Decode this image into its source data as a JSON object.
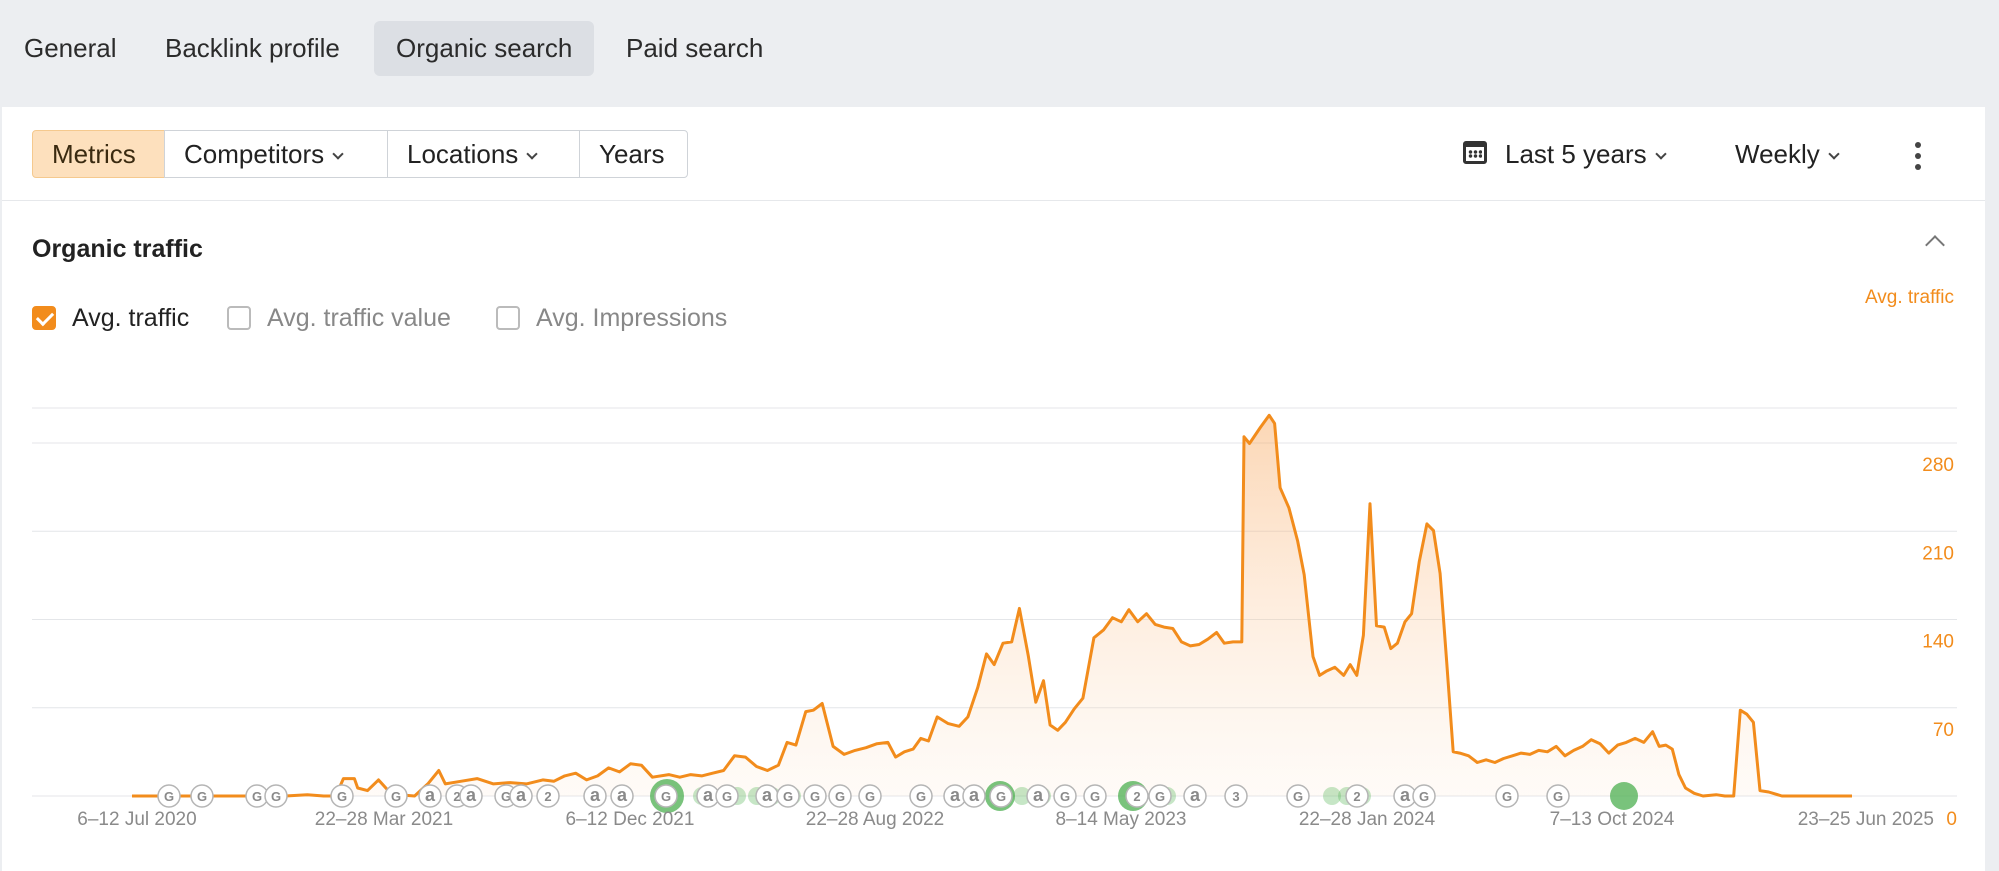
{
  "tabs": [
    {
      "label": "General",
      "active": false
    },
    {
      "label": "Backlink profile",
      "active": false
    },
    {
      "label": "Organic search",
      "active": true
    },
    {
      "label": "Paid search",
      "active": false
    }
  ],
  "toolbar": {
    "segments": [
      {
        "label": "Metrics",
        "active": true
      },
      {
        "label": "Competitors",
        "dropdown": true
      },
      {
        "label": "Locations",
        "dropdown": true
      },
      {
        "label": "Years",
        "dropdown": false
      }
    ],
    "date_range": "Last 5 years",
    "interval": "Weekly",
    "icons": {
      "calendar": "calendar-icon",
      "more": "more-vertical-icon"
    }
  },
  "section": {
    "title": "Organic traffic",
    "checkboxes": [
      {
        "label": "Avg. traffic",
        "checked": true
      },
      {
        "label": "Avg. traffic value",
        "checked": false
      },
      {
        "label": "Avg. Impressions",
        "checked": false
      }
    ]
  },
  "colors": {
    "accent": "#f28c1c",
    "marker_green": "#5cb85c",
    "marker_outline": "#b5b5b5"
  },
  "chart_data": {
    "type": "area",
    "series_label": "Avg. traffic",
    "y_ticks": [
      0,
      70,
      140,
      210,
      280
    ],
    "ylim": [
      0,
      285
    ],
    "x_tick_labels": [
      "6–12 Jul 2020",
      "22–28 Mar 2021",
      "6–12 Dec 2021",
      "22–28 Aug 2022",
      "8–14 May 2023",
      "22–28 Jan 2024",
      "7–13 Oct 2024",
      "23–25 Jun 2025"
    ],
    "grid": true,
    "points": [
      [
        0.0,
        0
      ],
      [
        0.02,
        0
      ],
      [
        0.09,
        0
      ],
      [
        0.14,
        0
      ],
      [
        0.16,
        1
      ],
      [
        0.175,
        0
      ],
      [
        0.186,
        0
      ],
      [
        0.193,
        13
      ],
      [
        0.203,
        13
      ],
      [
        0.206,
        6
      ],
      [
        0.215,
        4
      ],
      [
        0.225,
        12
      ],
      [
        0.235,
        3
      ],
      [
        0.243,
        1
      ],
      [
        0.258,
        0
      ],
      [
        0.27,
        9
      ],
      [
        0.28,
        19
      ],
      [
        0.286,
        9
      ],
      [
        0.3,
        11
      ],
      [
        0.315,
        13
      ],
      [
        0.33,
        9
      ],
      [
        0.345,
        10
      ],
      [
        0.36,
        9
      ],
      [
        0.375,
        12
      ],
      [
        0.385,
        11
      ],
      [
        0.395,
        15
      ],
      [
        0.405,
        17
      ],
      [
        0.415,
        12
      ],
      [
        0.425,
        15
      ],
      [
        0.435,
        21
      ],
      [
        0.445,
        18
      ],
      [
        0.455,
        24
      ],
      [
        0.465,
        23
      ],
      [
        0.475,
        14
      ],
      [
        0.49,
        16
      ],
      [
        0.5,
        14
      ],
      [
        0.51,
        16
      ],
      [
        0.52,
        15
      ],
      [
        0.53,
        17
      ],
      [
        0.54,
        19
      ],
      [
        0.55,
        30
      ],
      [
        0.56,
        29
      ],
      [
        0.57,
        22
      ],
      [
        0.58,
        19
      ],
      [
        0.59,
        23
      ],
      [
        0.598,
        40
      ],
      [
        0.606,
        38
      ],
      [
        0.615,
        63
      ],
      [
        0.622,
        64
      ],
      [
        0.63,
        69
      ],
      [
        0.64,
        37
      ],
      [
        0.65,
        31
      ],
      [
        0.66,
        34
      ],
      [
        0.67,
        36
      ],
      [
        0.68,
        39
      ],
      [
        0.69,
        40
      ],
      [
        0.697,
        29
      ],
      [
        0.705,
        33
      ],
      [
        0.713,
        35
      ],
      [
        0.72,
        43
      ],
      [
        0.727,
        41
      ],
      [
        0.735,
        59
      ],
      [
        0.745,
        54
      ],
      [
        0.755,
        52
      ],
      [
        0.763,
        59
      ],
      [
        0.772,
        81
      ],
      [
        0.78,
        106
      ],
      [
        0.787,
        98
      ],
      [
        0.795,
        114
      ],
      [
        0.803,
        115
      ],
      [
        0.81,
        140
      ],
      [
        0.818,
        105
      ],
      [
        0.825,
        70
      ],
      [
        0.832,
        86
      ],
      [
        0.838,
        53
      ],
      [
        0.845,
        49
      ],
      [
        0.852,
        55
      ],
      [
        0.86,
        65
      ],
      [
        0.868,
        73
      ],
      [
        0.878,
        118
      ],
      [
        0.887,
        124
      ],
      [
        0.895,
        133
      ],
      [
        0.903,
        130
      ],
      [
        0.91,
        139
      ],
      [
        0.918,
        130
      ],
      [
        0.926,
        136
      ],
      [
        0.934,
        128
      ],
      [
        0.942,
        126
      ],
      [
        0.95,
        125
      ],
      [
        0.958,
        115
      ],
      [
        0.966,
        112
      ],
      [
        0.974,
        113
      ],
      [
        0.982,
        117
      ],
      [
        0.99,
        122
      ],
      [
        0.997,
        114
      ],
      [
        1.005,
        115
      ],
      [
        1.013,
        115
      ],
      [
        1.015,
        268
      ],
      [
        1.02,
        263
      ],
      [
        1.03,
        275
      ],
      [
        1.038,
        284
      ],
      [
        1.043,
        278
      ],
      [
        1.048,
        230
      ],
      [
        1.056,
        215
      ],
      [
        1.064,
        190
      ],
      [
        1.07,
        165
      ],
      [
        1.078,
        104
      ],
      [
        1.084,
        90
      ],
      [
        1.09,
        93
      ],
      [
        1.098,
        96
      ],
      [
        1.106,
        90
      ],
      [
        1.112,
        98
      ],
      [
        1.118,
        90
      ],
      [
        1.124,
        120
      ],
      [
        1.13,
        218
      ],
      [
        1.136,
        127
      ],
      [
        1.143,
        126
      ],
      [
        1.149,
        110
      ],
      [
        1.155,
        114
      ],
      [
        1.162,
        130
      ],
      [
        1.168,
        136
      ],
      [
        1.175,
        175
      ],
      [
        1.182,
        203
      ],
      [
        1.188,
        198
      ],
      [
        1.194,
        166
      ],
      [
        1.2,
        101
      ],
      [
        1.206,
        33
      ],
      [
        1.212,
        32
      ],
      [
        1.22,
        30
      ],
      [
        1.228,
        25
      ],
      [
        1.236,
        27
      ],
      [
        1.244,
        25
      ],
      [
        1.252,
        28
      ],
      [
        1.26,
        30
      ],
      [
        1.268,
        32
      ],
      [
        1.276,
        31
      ],
      [
        1.284,
        34
      ],
      [
        1.292,
        33
      ],
      [
        1.3,
        37
      ],
      [
        1.308,
        30
      ],
      [
        1.316,
        34
      ],
      [
        1.324,
        37
      ],
      [
        1.332,
        42
      ],
      [
        1.34,
        39
      ],
      [
        1.348,
        32
      ],
      [
        1.356,
        38
      ],
      [
        1.364,
        40
      ],
      [
        1.372,
        43
      ],
      [
        1.38,
        40
      ],
      [
        1.388,
        48
      ],
      [
        1.394,
        37
      ],
      [
        1.4,
        38
      ],
      [
        1.406,
        35
      ],
      [
        1.412,
        16
      ],
      [
        1.418,
        6
      ],
      [
        1.426,
        2
      ],
      [
        1.434,
        0
      ],
      [
        1.446,
        1
      ],
      [
        1.454,
        0
      ],
      [
        1.462,
        0
      ],
      [
        1.468,
        64
      ],
      [
        1.474,
        61
      ],
      [
        1.48,
        55
      ],
      [
        1.486,
        4
      ],
      [
        1.494,
        3
      ],
      [
        1.506,
        0
      ],
      [
        1.53,
        0
      ],
      [
        1.57,
        0
      ]
    ],
    "event_markers": [
      "G",
      "G",
      "G",
      "G",
      "G",
      "G",
      "a",
      "2",
      "a",
      "G",
      "a",
      "2",
      "a",
      "a",
      "G",
      "a",
      "G",
      "a",
      "G",
      "G",
      "G",
      "G",
      "G",
      "a",
      "a",
      "G",
      "a",
      "G",
      "G",
      "2",
      "G",
      "a",
      "3",
      "G",
      "2",
      "a",
      "G",
      "G",
      "G"
    ]
  }
}
